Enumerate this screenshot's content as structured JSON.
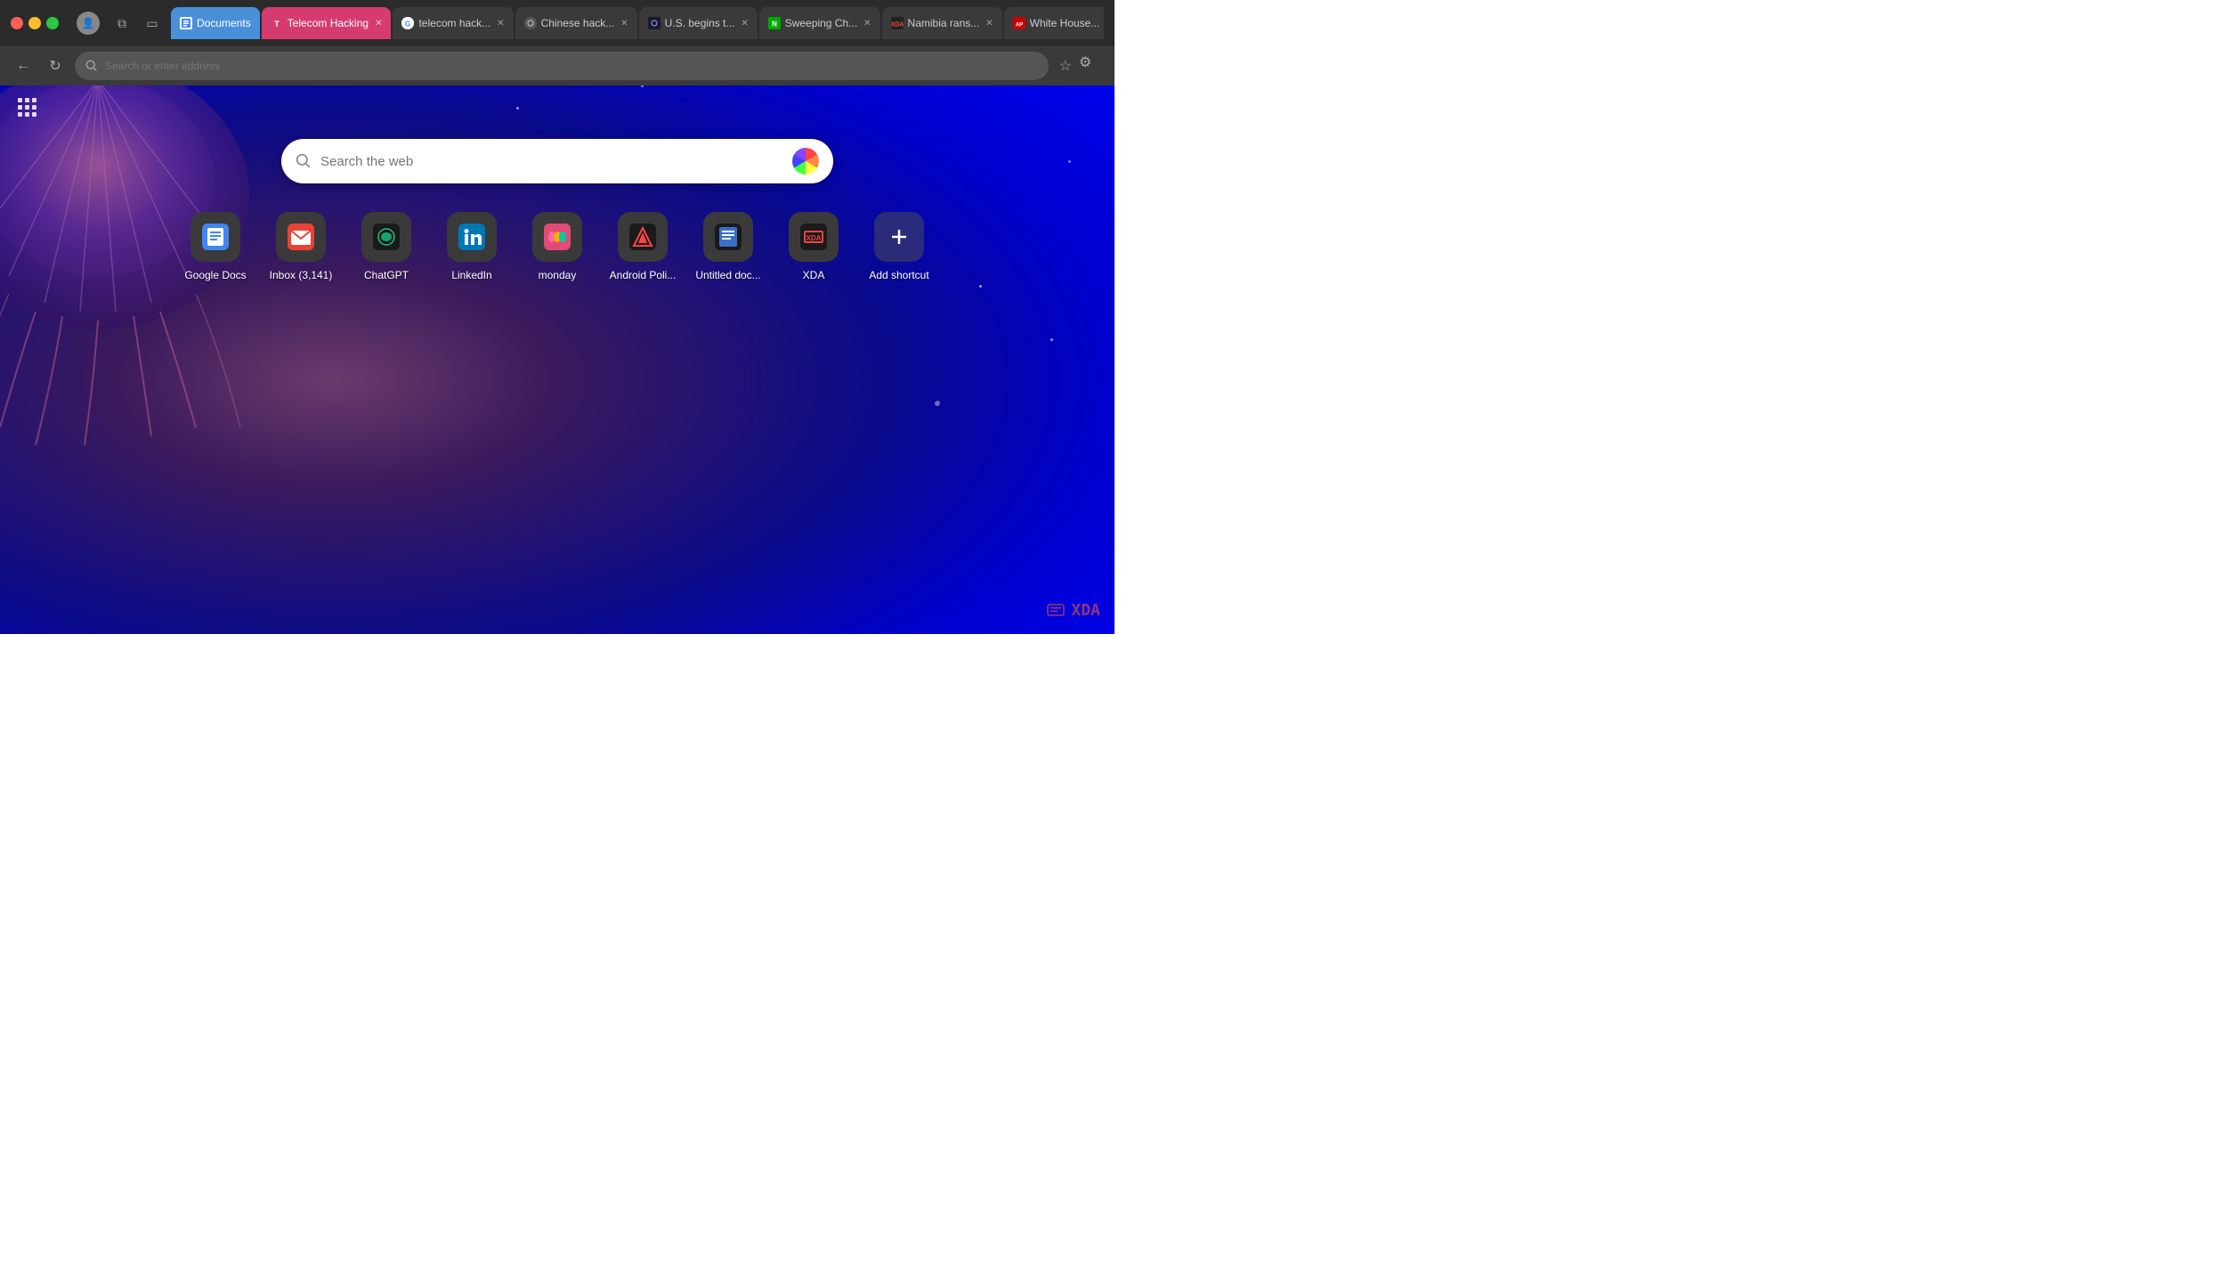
{
  "titlebar": {
    "traffic_lights": [
      "red",
      "yellow",
      "green"
    ],
    "tabs": [
      {
        "label": "Documents",
        "active": false,
        "special": true,
        "favicon": "docs",
        "closeable": false
      },
      {
        "label": "Telecom Hacking",
        "active": true,
        "special": false,
        "favicon": "telecom",
        "closeable": true
      },
      {
        "label": "telecom hack...",
        "active": false,
        "special": false,
        "favicon": "google",
        "closeable": true
      },
      {
        "label": "Chinese hack...",
        "active": false,
        "special": false,
        "favicon": "generic",
        "closeable": true
      },
      {
        "label": "U.S. begins t...",
        "active": false,
        "special": false,
        "favicon": "eye",
        "closeable": true
      },
      {
        "label": "Sweeping Ch...",
        "active": false,
        "special": false,
        "favicon": "nbc",
        "closeable": true
      },
      {
        "label": "Namibia rans...",
        "active": false,
        "special": false,
        "favicon": "xda",
        "closeable": true
      },
      {
        "label": "White House...",
        "active": false,
        "special": false,
        "favicon": "ap",
        "closeable": true
      }
    ]
  },
  "toolbar": {
    "back_label": "←",
    "reload_label": "↻",
    "search_placeholder": "Search or enter address",
    "bookmark_icon": "☆",
    "settings_icon": "⚙"
  },
  "search": {
    "placeholder": "Search the web"
  },
  "shortcuts": [
    {
      "id": "google-docs",
      "label": "Google Docs",
      "icon_type": "docs"
    },
    {
      "id": "inbox",
      "label": "Inbox (3,141)",
      "icon_type": "inbox"
    },
    {
      "id": "chatgpt",
      "label": "ChatGPT",
      "icon_type": "chatgpt"
    },
    {
      "id": "linkedin",
      "label": "LinkedIn",
      "icon_type": "linkedin"
    },
    {
      "id": "monday",
      "label": "monday",
      "icon_type": "monday"
    },
    {
      "id": "android-police",
      "label": "Android Poli...",
      "icon_type": "androidpoli"
    },
    {
      "id": "untitled-doc",
      "label": "Untitled doc...",
      "icon_type": "untitled"
    },
    {
      "id": "xda",
      "label": "XDA",
      "icon_type": "xda"
    },
    {
      "id": "add-shortcut",
      "label": "Add shortcut",
      "icon_type": "add"
    }
  ],
  "apps_grid_label": "⋮⋮⋮",
  "xda_watermark": "⬛ XDA"
}
